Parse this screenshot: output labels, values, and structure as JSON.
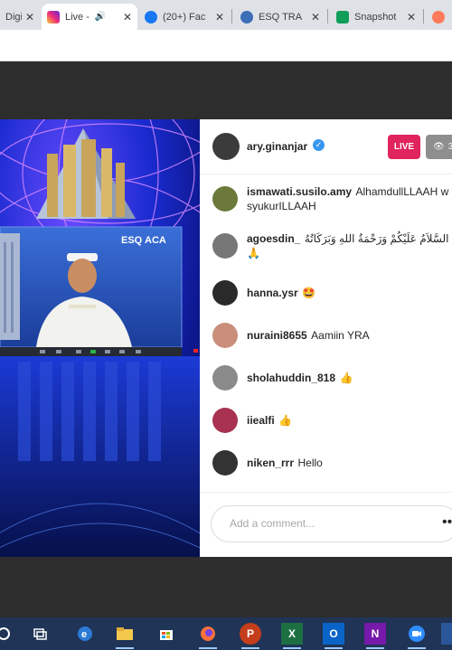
{
  "browser": {
    "tabs": [
      {
        "title": "Digi",
        "favicon": "digi-icon"
      },
      {
        "title": "Live -",
        "favicon": "instagram-icon",
        "active": true
      },
      {
        "title": "(20+) Fac",
        "favicon": "facebook-icon"
      },
      {
        "title": "ESQ TRA",
        "favicon": "esq-icon"
      },
      {
        "title": "Snapshot",
        "favicon": "sheets-icon"
      },
      {
        "title": "",
        "favicon": "hubspot-icon"
      }
    ]
  },
  "stream": {
    "host": "ary.ginanjar",
    "live_label": "LIVE",
    "viewers": "3"
  },
  "comments": [
    {
      "user": "ismawati.susilo.amy",
      "text": "AlhamdullLLAAH w syukurILLAAH",
      "avatar_color": "#6b7a3a"
    },
    {
      "user": "agoesdin_",
      "text": "السَّلاَمُ عَلَيْكُمْ وَرَحْمَةُ اللهِ وَبَرَكَاتُهُ 🙏",
      "avatar_color": "#777777"
    },
    {
      "user": "hanna.ysr",
      "text": "🤩",
      "avatar_color": "#2a2a2a"
    },
    {
      "user": "nuraini8655",
      "text": "Aamiin YRA",
      "avatar_color": "#c98f7a"
    },
    {
      "user": "sholahuddin_818",
      "text": "👍",
      "avatar_color": "#8a8a8a"
    },
    {
      "user": "iiealfi",
      "text": "👍",
      "avatar_color": "#a83250"
    },
    {
      "user": "niken_rrr",
      "text": "Hello",
      "avatar_color": "#333333"
    }
  ],
  "comment_box": {
    "placeholder": "Add a comment..."
  },
  "video": {
    "logo_esq": "ESQ",
    "logo_aca": "ACA"
  },
  "taskbar": [
    {
      "icon": "cortana-icon"
    },
    {
      "icon": "task-view-icon"
    },
    {
      "icon": "edge-icon"
    },
    {
      "icon": "file-explorer-icon"
    },
    {
      "icon": "store-icon"
    },
    {
      "icon": "firefox-icon"
    },
    {
      "icon": "powerpoint-icon",
      "label": "P"
    },
    {
      "icon": "excel-icon",
      "label": "X"
    },
    {
      "icon": "outlook-icon",
      "label": "O"
    },
    {
      "icon": "onenote-icon",
      "label": "N"
    },
    {
      "icon": "zoom-icon"
    },
    {
      "icon": "word-icon"
    }
  ]
}
